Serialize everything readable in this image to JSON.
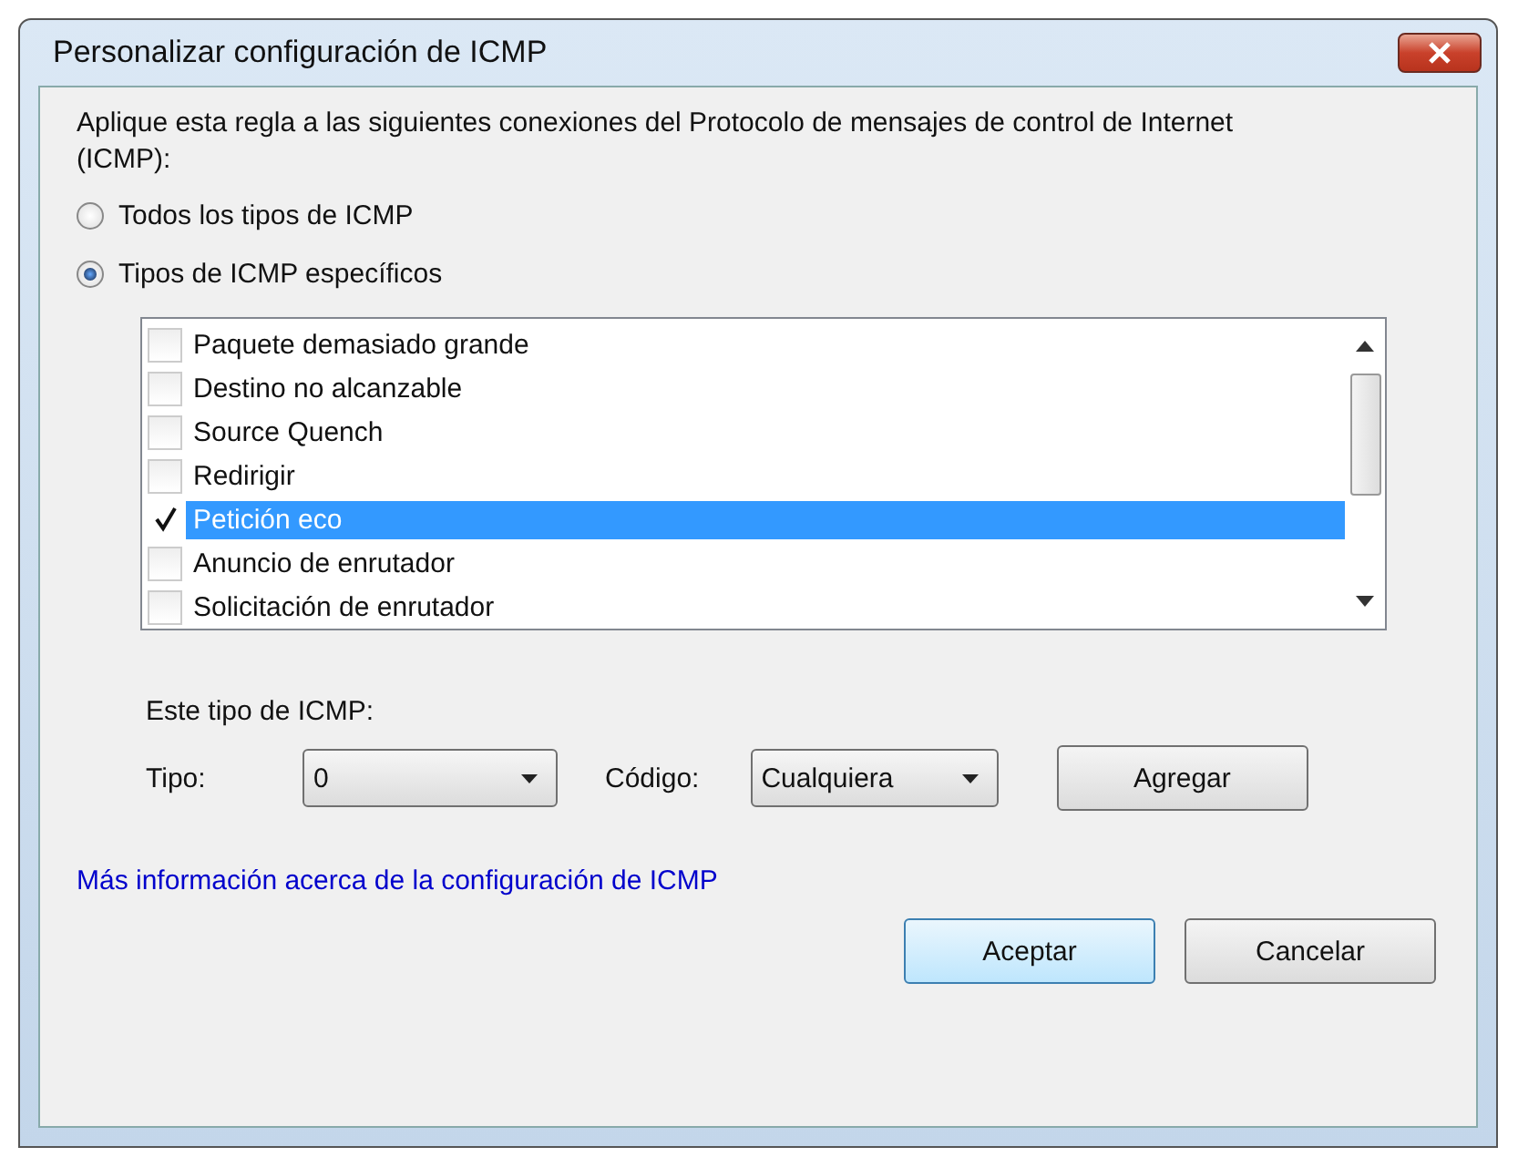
{
  "window": {
    "title": "Personalizar configuración de ICMP"
  },
  "intro": "Aplique esta regla a las siguientes conexiones del Protocolo de mensajes de control de Internet (ICMP):",
  "radios": [
    {
      "label": "Todos los tipos de ICMP",
      "selected": false
    },
    {
      "label": "Tipos de ICMP específicos",
      "selected": true
    }
  ],
  "icmp_types": [
    {
      "label": "Paquete demasiado grande",
      "checked": false,
      "selected": false
    },
    {
      "label": "Destino no alcanzable",
      "checked": false,
      "selected": false
    },
    {
      "label": "Source Quench",
      "checked": false,
      "selected": false
    },
    {
      "label": "Redirigir",
      "checked": false,
      "selected": false
    },
    {
      "label": "Petición eco",
      "checked": true,
      "selected": true
    },
    {
      "label": "Anuncio de enrutador",
      "checked": false,
      "selected": false
    },
    {
      "label": "Solicitación de enrutador",
      "checked": false,
      "selected": false
    }
  ],
  "this_type": {
    "heading": "Este tipo de ICMP:",
    "type_label": "Tipo:",
    "type_value": "0",
    "code_label": "Código:",
    "code_value": "Cualquiera",
    "add_button": "Agregar"
  },
  "link": "Más información acerca de la configuración de ICMP",
  "buttons": [
    "Aceptar",
    "Cancelar"
  ]
}
